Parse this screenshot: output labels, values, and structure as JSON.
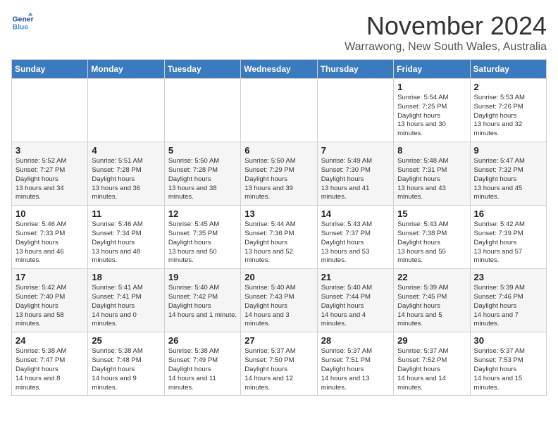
{
  "logo": {
    "line1": "General",
    "line2": "Blue"
  },
  "title": "November 2024",
  "location": "Warrawong, New South Wales, Australia",
  "weekdays": [
    "Sunday",
    "Monday",
    "Tuesday",
    "Wednesday",
    "Thursday",
    "Friday",
    "Saturday"
  ],
  "weeks": [
    [
      {
        "day": "",
        "content": ""
      },
      {
        "day": "",
        "content": ""
      },
      {
        "day": "",
        "content": ""
      },
      {
        "day": "",
        "content": ""
      },
      {
        "day": "",
        "content": ""
      },
      {
        "day": "1",
        "content": "Sunrise: 5:54 AM\nSunset: 7:25 PM\nDaylight: 13 hours and 30 minutes."
      },
      {
        "day": "2",
        "content": "Sunrise: 5:53 AM\nSunset: 7:26 PM\nDaylight: 13 hours and 32 minutes."
      }
    ],
    [
      {
        "day": "3",
        "content": "Sunrise: 5:52 AM\nSunset: 7:27 PM\nDaylight: 13 hours and 34 minutes."
      },
      {
        "day": "4",
        "content": "Sunrise: 5:51 AM\nSunset: 7:28 PM\nDaylight: 13 hours and 36 minutes."
      },
      {
        "day": "5",
        "content": "Sunrise: 5:50 AM\nSunset: 7:28 PM\nDaylight: 13 hours and 38 minutes."
      },
      {
        "day": "6",
        "content": "Sunrise: 5:50 AM\nSunset: 7:29 PM\nDaylight: 13 hours and 39 minutes."
      },
      {
        "day": "7",
        "content": "Sunrise: 5:49 AM\nSunset: 7:30 PM\nDaylight: 13 hours and 41 minutes."
      },
      {
        "day": "8",
        "content": "Sunrise: 5:48 AM\nSunset: 7:31 PM\nDaylight: 13 hours and 43 minutes."
      },
      {
        "day": "9",
        "content": "Sunrise: 5:47 AM\nSunset: 7:32 PM\nDaylight: 13 hours and 45 minutes."
      }
    ],
    [
      {
        "day": "10",
        "content": "Sunrise: 5:46 AM\nSunset: 7:33 PM\nDaylight: 13 hours and 46 minutes."
      },
      {
        "day": "11",
        "content": "Sunrise: 5:46 AM\nSunset: 7:34 PM\nDaylight: 13 hours and 48 minutes."
      },
      {
        "day": "12",
        "content": "Sunrise: 5:45 AM\nSunset: 7:35 PM\nDaylight: 13 hours and 50 minutes."
      },
      {
        "day": "13",
        "content": "Sunrise: 5:44 AM\nSunset: 7:36 PM\nDaylight: 13 hours and 52 minutes."
      },
      {
        "day": "14",
        "content": "Sunrise: 5:43 AM\nSunset: 7:37 PM\nDaylight: 13 hours and 53 minutes."
      },
      {
        "day": "15",
        "content": "Sunrise: 5:43 AM\nSunset: 7:38 PM\nDaylight: 13 hours and 55 minutes."
      },
      {
        "day": "16",
        "content": "Sunrise: 5:42 AM\nSunset: 7:39 PM\nDaylight: 13 hours and 57 minutes."
      }
    ],
    [
      {
        "day": "17",
        "content": "Sunrise: 5:42 AM\nSunset: 7:40 PM\nDaylight: 13 hours and 58 minutes."
      },
      {
        "day": "18",
        "content": "Sunrise: 5:41 AM\nSunset: 7:41 PM\nDaylight: 14 hours and 0 minutes."
      },
      {
        "day": "19",
        "content": "Sunrise: 5:40 AM\nSunset: 7:42 PM\nDaylight: 14 hours and 1 minute."
      },
      {
        "day": "20",
        "content": "Sunrise: 5:40 AM\nSunset: 7:43 PM\nDaylight: 14 hours and 3 minutes."
      },
      {
        "day": "21",
        "content": "Sunrise: 5:40 AM\nSunset: 7:44 PM\nDaylight: 14 hours and 4 minutes."
      },
      {
        "day": "22",
        "content": "Sunrise: 5:39 AM\nSunset: 7:45 PM\nDaylight: 14 hours and 5 minutes."
      },
      {
        "day": "23",
        "content": "Sunrise: 5:39 AM\nSunset: 7:46 PM\nDaylight: 14 hours and 7 minutes."
      }
    ],
    [
      {
        "day": "24",
        "content": "Sunrise: 5:38 AM\nSunset: 7:47 PM\nDaylight: 14 hours and 8 minutes."
      },
      {
        "day": "25",
        "content": "Sunrise: 5:38 AM\nSunset: 7:48 PM\nDaylight: 14 hours and 9 minutes."
      },
      {
        "day": "26",
        "content": "Sunrise: 5:38 AM\nSunset: 7:49 PM\nDaylight: 14 hours and 11 minutes."
      },
      {
        "day": "27",
        "content": "Sunrise: 5:37 AM\nSunset: 7:50 PM\nDaylight: 14 hours and 12 minutes."
      },
      {
        "day": "28",
        "content": "Sunrise: 5:37 AM\nSunset: 7:51 PM\nDaylight: 14 hours and 13 minutes."
      },
      {
        "day": "29",
        "content": "Sunrise: 5:37 AM\nSunset: 7:52 PM\nDaylight: 14 hours and 14 minutes."
      },
      {
        "day": "30",
        "content": "Sunrise: 5:37 AM\nSunset: 7:53 PM\nDaylight: 14 hours and 15 minutes."
      }
    ]
  ]
}
